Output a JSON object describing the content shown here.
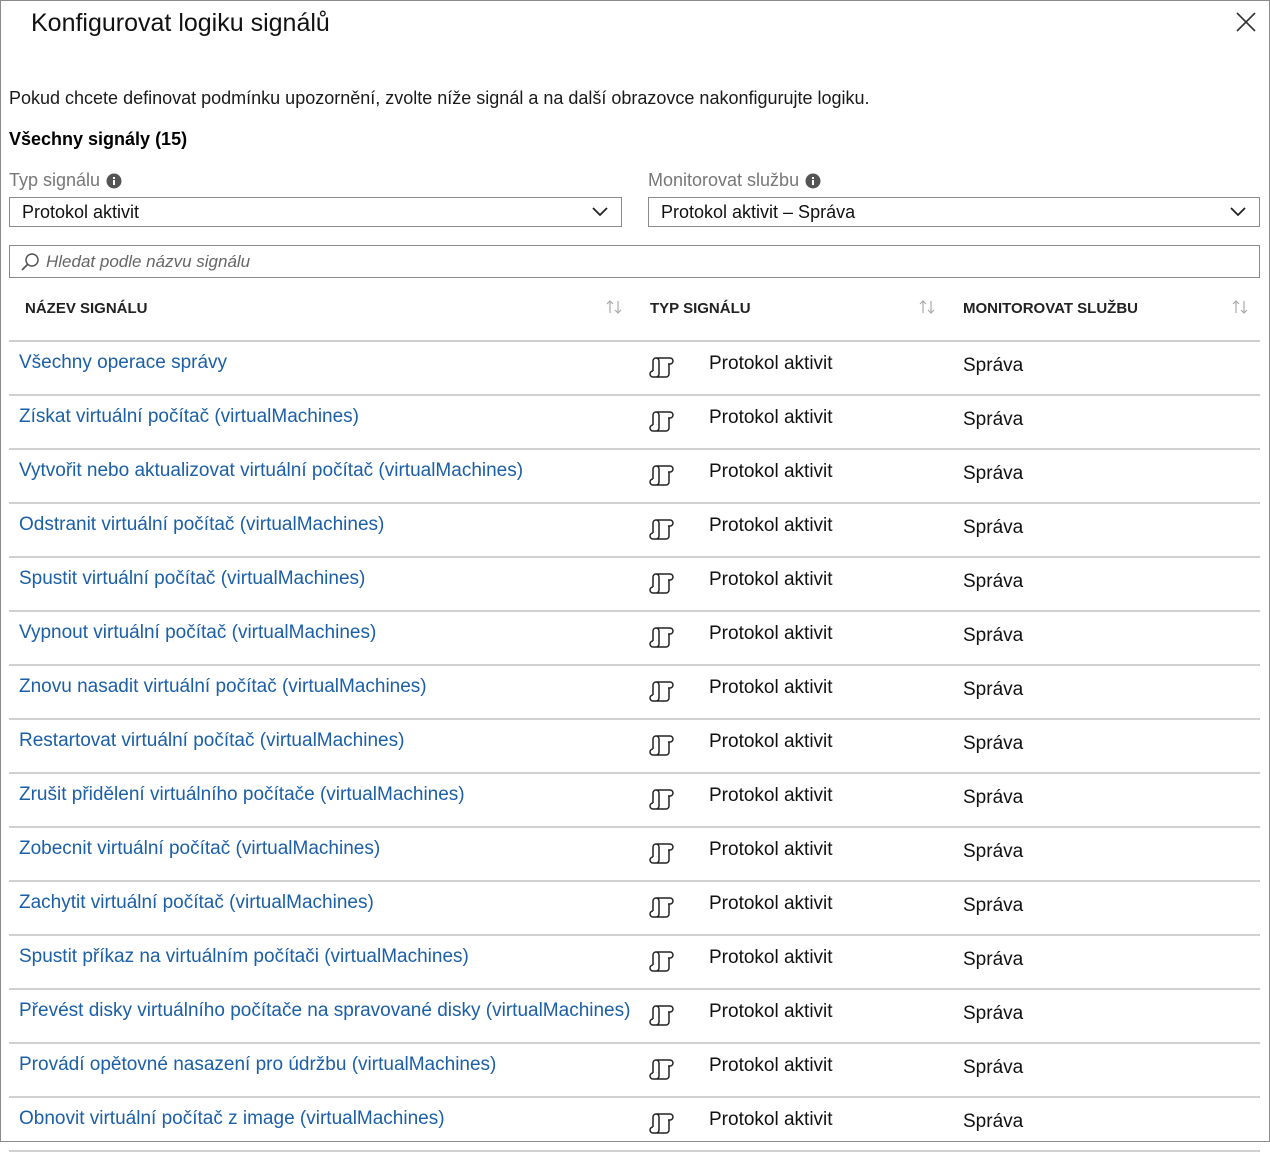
{
  "title": "Konfigurovat logiku signálů",
  "description": "Pokud chcete definovat podmínku upozornění, zvolte níže signál a na další obrazovce nakonfigurujte logiku.",
  "signals_count_label": "Všechny signály (15)",
  "filters": {
    "signal_type": {
      "label": "Typ signálu",
      "value": "Protokol aktivit"
    },
    "monitor_service": {
      "label": "Monitorovat službu",
      "value": "Protokol aktivit – Správa"
    }
  },
  "search": {
    "placeholder": "Hledat podle názvu signálu"
  },
  "columns": {
    "name": "NÁZEV SIGNÁLU",
    "type": "TYP SIGNÁLU",
    "service": "MONITOROVAT SLUŽBU"
  },
  "rows": [
    {
      "name": "Všechny operace správy",
      "type": "Protokol aktivit",
      "service": "Správa"
    },
    {
      "name": "Získat virtuální počítač (virtualMachines)",
      "type": "Protokol aktivit",
      "service": "Správa"
    },
    {
      "name": "Vytvořit nebo aktualizovat virtuální počítač (virtualMachines)",
      "type": "Protokol aktivit",
      "service": "Správa"
    },
    {
      "name": "Odstranit virtuální počítač (virtualMachines)",
      "type": "Protokol aktivit",
      "service": "Správa"
    },
    {
      "name": "Spustit virtuální počítač (virtualMachines)",
      "type": "Protokol aktivit",
      "service": "Správa"
    },
    {
      "name": "Vypnout virtuální počítač (virtualMachines)",
      "type": "Protokol aktivit",
      "service": "Správa"
    },
    {
      "name": "Znovu nasadit virtuální počítač (virtualMachines)",
      "type": "Protokol aktivit",
      "service": "Správa"
    },
    {
      "name": "Restartovat virtuální počítač (virtualMachines)",
      "type": "Protokol aktivit",
      "service": "Správa"
    },
    {
      "name": "Zrušit přidělení virtuálního počítače (virtualMachines)",
      "type": "Protokol aktivit",
      "service": "Správa"
    },
    {
      "name": "Zobecnit virtuální počítač (virtualMachines)",
      "type": "Protokol aktivit",
      "service": "Správa"
    },
    {
      "name": "Zachytit virtuální počítač (virtualMachines)",
      "type": "Protokol aktivit",
      "service": "Správa"
    },
    {
      "name": "Spustit příkaz na virtuálním počítači (virtualMachines)",
      "type": "Protokol aktivit",
      "service": "Správa"
    },
    {
      "name": "Převést disky virtuálního počítače na spravované disky (virtualMachines)",
      "type": "Protokol aktivit",
      "service": "Správa"
    },
    {
      "name": "Provádí opětovné nasazení pro údržbu (virtualMachines)",
      "type": "Protokol aktivit",
      "service": "Správa"
    },
    {
      "name": "Obnovit virtuální počítač z image (virtualMachines)",
      "type": "Protokol aktivit",
      "service": "Správa"
    }
  ],
  "icons": {
    "close": "close-icon",
    "info": "info-icon",
    "dropdown": "chevron-down-icon",
    "search": "search-icon",
    "sort": "sort-icon",
    "row_type": "activity-log-icon"
  },
  "colors": {
    "link": "#1b5fa8",
    "label_gray": "#777777",
    "border": "#8a8a8a",
    "row_divider": "#d0d0d0"
  }
}
